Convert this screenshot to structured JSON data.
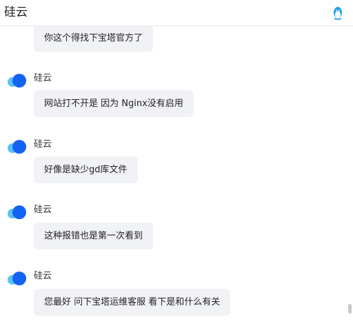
{
  "header": {
    "title": "硅云",
    "icon": "qq-penguin-icon",
    "icon_color": "#1ea0f2"
  },
  "messages": [
    {
      "sender": "",
      "text": "你这个得找下宝塔官方了"
    },
    {
      "sender": "硅云",
      "text": "网站打不开是 因为 Nginx没有启用"
    },
    {
      "sender": "硅云",
      "text": "好像是缺少gd库文件"
    },
    {
      "sender": "硅云",
      "text": "这种报错也是第一次看到"
    },
    {
      "sender": "硅云",
      "text": "您最好   问下宝塔运维客服  看下是和什么有关"
    }
  ],
  "colors": {
    "bubble_bg": "#f1f2f5",
    "avatar_primary": "#1463f3",
    "avatar_secondary": "#5bc2f5"
  }
}
